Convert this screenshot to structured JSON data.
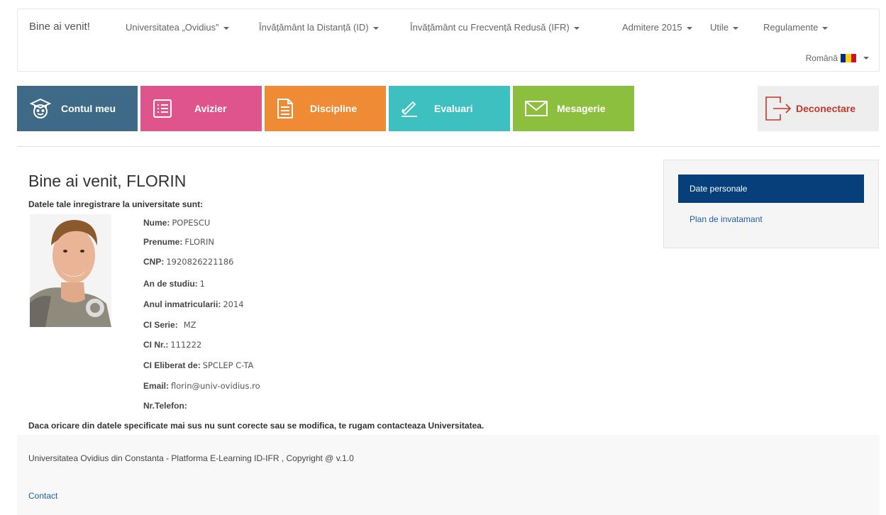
{
  "navbar": {
    "brand": "Bine ai venit!",
    "items": [
      {
        "label": "Universitatea „Ovidius”"
      },
      {
        "label": "Învățământ la Distanță (ID)"
      },
      {
        "label": "Învățământ cu Frecvență Redusă (IFR)"
      },
      {
        "label": "Admitere 2015"
      },
      {
        "label": "Utile"
      },
      {
        "label": "Regulamente"
      }
    ],
    "language": "Română",
    "flag_colors": [
      "#002b7f",
      "#fcd116",
      "#ce1126"
    ]
  },
  "tiles": [
    {
      "label": "Contul meu",
      "icon": "student-icon",
      "color": "#3e6a88"
    },
    {
      "label": "Avizier",
      "icon": "list-icon",
      "color": "#e0548e"
    },
    {
      "label": "Discipline",
      "icon": "document-icon",
      "color": "#ef8b35"
    },
    {
      "label": "Evaluari",
      "icon": "signature-icon",
      "color": "#3fc0c0"
    },
    {
      "label": "Mesagerie",
      "icon": "envelope-icon",
      "color": "#8dbf3e"
    }
  ],
  "logout": {
    "label": "Deconectare",
    "icon": "logout-icon",
    "color": "#c0392b"
  },
  "main": {
    "welcome": "Bine ai venit, FLORIN",
    "registration_title": "Datele tale inregistrare la universitate sunt:",
    "fields": [
      {
        "label": "Nume:",
        "value": "POPESCU"
      },
      {
        "label": "Prenume:",
        "value": "FLORIN"
      },
      {
        "label": "CNP:",
        "value": "1920826221186"
      },
      {
        "label": "An de studiu:",
        "value": "1"
      },
      {
        "label": "Anul inmatricularii:",
        "value": "2014"
      },
      {
        "label": "CI Serie:",
        "value": "MZ"
      },
      {
        "label": "CI Nr.:",
        "value": "111222"
      },
      {
        "label": "CI Eliberat de:",
        "value": "SPCLEP C-TA"
      },
      {
        "label": "Email:",
        "value": "florin@univ-ovidius.ro"
      },
      {
        "label": "Nr.Telefon:",
        "value": ""
      }
    ],
    "notice": "Daca oricare din datele specificate mai sus nu sunt corecte sau se modifica, te rugam contacteaza Universitatea."
  },
  "side": {
    "active": "Date personale",
    "link": "Plan de invatamant",
    "active_color": "#063f7a"
  },
  "footer": {
    "text": "Universitatea Ovidius din Constanta - Platforma E-Learning ID-IFR , Copyright @ v.1.0",
    "link": "Contact"
  }
}
